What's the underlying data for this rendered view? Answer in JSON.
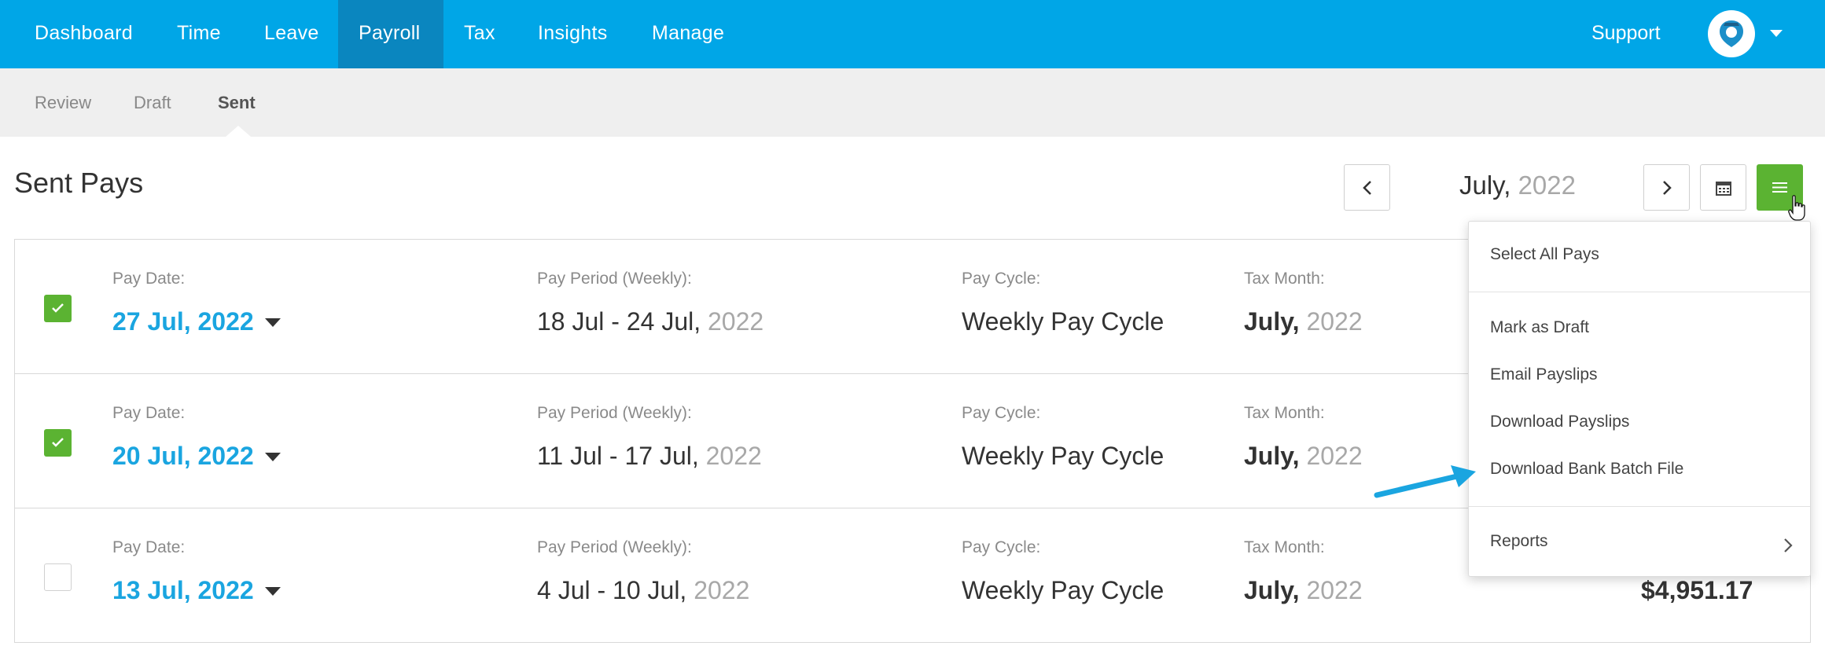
{
  "nav": {
    "items": [
      "Dashboard",
      "Time",
      "Leave",
      "Payroll",
      "Tax",
      "Insights",
      "Manage"
    ],
    "active": "Payroll",
    "support": "Support"
  },
  "subnav": {
    "items": [
      "Review",
      "Draft",
      "Sent"
    ],
    "active": "Sent"
  },
  "header": {
    "title": "Sent Pays",
    "month": "July,",
    "year": "2022"
  },
  "labels": {
    "pay_date": "Pay Date:",
    "pay_period": "Pay Period (Weekly):",
    "pay_cycle": "Pay Cycle:",
    "tax_month": "Tax Month:"
  },
  "rows": [
    {
      "checked": true,
      "pay_date": "27 Jul, 2022",
      "period": "18 Jul - 24 Jul,",
      "period_year": "2022",
      "cycle": "Weekly Pay Cycle",
      "tax_month": "July,",
      "tax_year": "2022",
      "amount": ""
    },
    {
      "checked": true,
      "pay_date": "20 Jul, 2022",
      "period": "11 Jul - 17 Jul,",
      "period_year": "2022",
      "cycle": "Weekly Pay Cycle",
      "tax_month": "July,",
      "tax_year": "2022",
      "amount": ""
    },
    {
      "checked": false,
      "pay_date": "13 Jul, 2022",
      "period": "4 Jul - 10 Jul,",
      "period_year": "2022",
      "cycle": "Weekly Pay Cycle",
      "tax_month": "July,",
      "tax_year": "2022",
      "amount": "$4,951.17"
    }
  ],
  "menu": {
    "select_all": "Select All Pays",
    "mark_draft": "Mark as Draft",
    "email_payslips": "Email Payslips",
    "download_payslips": "Download Payslips",
    "download_bank_batch": "Download Bank Batch File",
    "reports": "Reports"
  },
  "colors": {
    "nav_bg": "#00a6e7",
    "nav_active": "#0a86bf",
    "accent_green": "#5bb332",
    "link_blue": "#1aa5e0"
  }
}
